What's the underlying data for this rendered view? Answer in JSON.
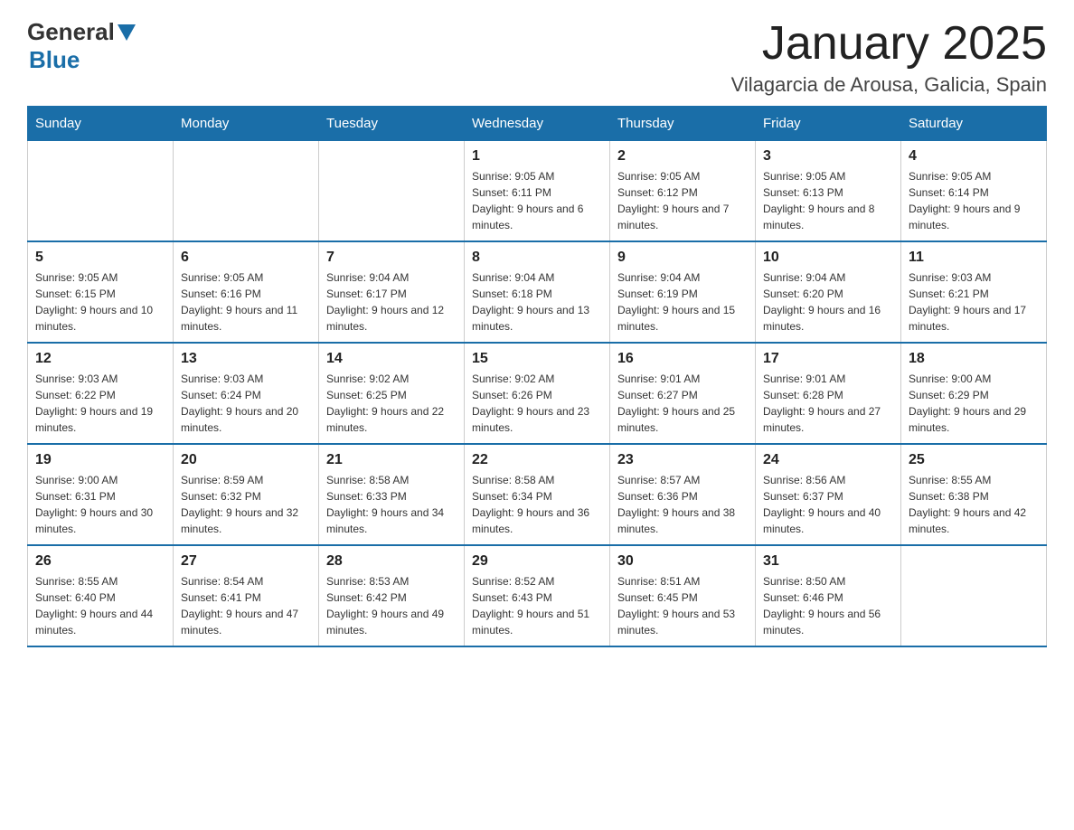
{
  "header": {
    "logo_general": "General",
    "logo_blue": "Blue",
    "month_title": "January 2025",
    "location": "Vilagarcia de Arousa, Galicia, Spain"
  },
  "days_of_week": [
    "Sunday",
    "Monday",
    "Tuesday",
    "Wednesday",
    "Thursday",
    "Friday",
    "Saturday"
  ],
  "weeks": [
    [
      {
        "day": "",
        "info": ""
      },
      {
        "day": "",
        "info": ""
      },
      {
        "day": "",
        "info": ""
      },
      {
        "day": "1",
        "info": "Sunrise: 9:05 AM\nSunset: 6:11 PM\nDaylight: 9 hours and 6 minutes."
      },
      {
        "day": "2",
        "info": "Sunrise: 9:05 AM\nSunset: 6:12 PM\nDaylight: 9 hours and 7 minutes."
      },
      {
        "day": "3",
        "info": "Sunrise: 9:05 AM\nSunset: 6:13 PM\nDaylight: 9 hours and 8 minutes."
      },
      {
        "day": "4",
        "info": "Sunrise: 9:05 AM\nSunset: 6:14 PM\nDaylight: 9 hours and 9 minutes."
      }
    ],
    [
      {
        "day": "5",
        "info": "Sunrise: 9:05 AM\nSunset: 6:15 PM\nDaylight: 9 hours and 10 minutes."
      },
      {
        "day": "6",
        "info": "Sunrise: 9:05 AM\nSunset: 6:16 PM\nDaylight: 9 hours and 11 minutes."
      },
      {
        "day": "7",
        "info": "Sunrise: 9:04 AM\nSunset: 6:17 PM\nDaylight: 9 hours and 12 minutes."
      },
      {
        "day": "8",
        "info": "Sunrise: 9:04 AM\nSunset: 6:18 PM\nDaylight: 9 hours and 13 minutes."
      },
      {
        "day": "9",
        "info": "Sunrise: 9:04 AM\nSunset: 6:19 PM\nDaylight: 9 hours and 15 minutes."
      },
      {
        "day": "10",
        "info": "Sunrise: 9:04 AM\nSunset: 6:20 PM\nDaylight: 9 hours and 16 minutes."
      },
      {
        "day": "11",
        "info": "Sunrise: 9:03 AM\nSunset: 6:21 PM\nDaylight: 9 hours and 17 minutes."
      }
    ],
    [
      {
        "day": "12",
        "info": "Sunrise: 9:03 AM\nSunset: 6:22 PM\nDaylight: 9 hours and 19 minutes."
      },
      {
        "day": "13",
        "info": "Sunrise: 9:03 AM\nSunset: 6:24 PM\nDaylight: 9 hours and 20 minutes."
      },
      {
        "day": "14",
        "info": "Sunrise: 9:02 AM\nSunset: 6:25 PM\nDaylight: 9 hours and 22 minutes."
      },
      {
        "day": "15",
        "info": "Sunrise: 9:02 AM\nSunset: 6:26 PM\nDaylight: 9 hours and 23 minutes."
      },
      {
        "day": "16",
        "info": "Sunrise: 9:01 AM\nSunset: 6:27 PM\nDaylight: 9 hours and 25 minutes."
      },
      {
        "day": "17",
        "info": "Sunrise: 9:01 AM\nSunset: 6:28 PM\nDaylight: 9 hours and 27 minutes."
      },
      {
        "day": "18",
        "info": "Sunrise: 9:00 AM\nSunset: 6:29 PM\nDaylight: 9 hours and 29 minutes."
      }
    ],
    [
      {
        "day": "19",
        "info": "Sunrise: 9:00 AM\nSunset: 6:31 PM\nDaylight: 9 hours and 30 minutes."
      },
      {
        "day": "20",
        "info": "Sunrise: 8:59 AM\nSunset: 6:32 PM\nDaylight: 9 hours and 32 minutes."
      },
      {
        "day": "21",
        "info": "Sunrise: 8:58 AM\nSunset: 6:33 PM\nDaylight: 9 hours and 34 minutes."
      },
      {
        "day": "22",
        "info": "Sunrise: 8:58 AM\nSunset: 6:34 PM\nDaylight: 9 hours and 36 minutes."
      },
      {
        "day": "23",
        "info": "Sunrise: 8:57 AM\nSunset: 6:36 PM\nDaylight: 9 hours and 38 minutes."
      },
      {
        "day": "24",
        "info": "Sunrise: 8:56 AM\nSunset: 6:37 PM\nDaylight: 9 hours and 40 minutes."
      },
      {
        "day": "25",
        "info": "Sunrise: 8:55 AM\nSunset: 6:38 PM\nDaylight: 9 hours and 42 minutes."
      }
    ],
    [
      {
        "day": "26",
        "info": "Sunrise: 8:55 AM\nSunset: 6:40 PM\nDaylight: 9 hours and 44 minutes."
      },
      {
        "day": "27",
        "info": "Sunrise: 8:54 AM\nSunset: 6:41 PM\nDaylight: 9 hours and 47 minutes."
      },
      {
        "day": "28",
        "info": "Sunrise: 8:53 AM\nSunset: 6:42 PM\nDaylight: 9 hours and 49 minutes."
      },
      {
        "day": "29",
        "info": "Sunrise: 8:52 AM\nSunset: 6:43 PM\nDaylight: 9 hours and 51 minutes."
      },
      {
        "day": "30",
        "info": "Sunrise: 8:51 AM\nSunset: 6:45 PM\nDaylight: 9 hours and 53 minutes."
      },
      {
        "day": "31",
        "info": "Sunrise: 8:50 AM\nSunset: 6:46 PM\nDaylight: 9 hours and 56 minutes."
      },
      {
        "day": "",
        "info": ""
      }
    ]
  ]
}
